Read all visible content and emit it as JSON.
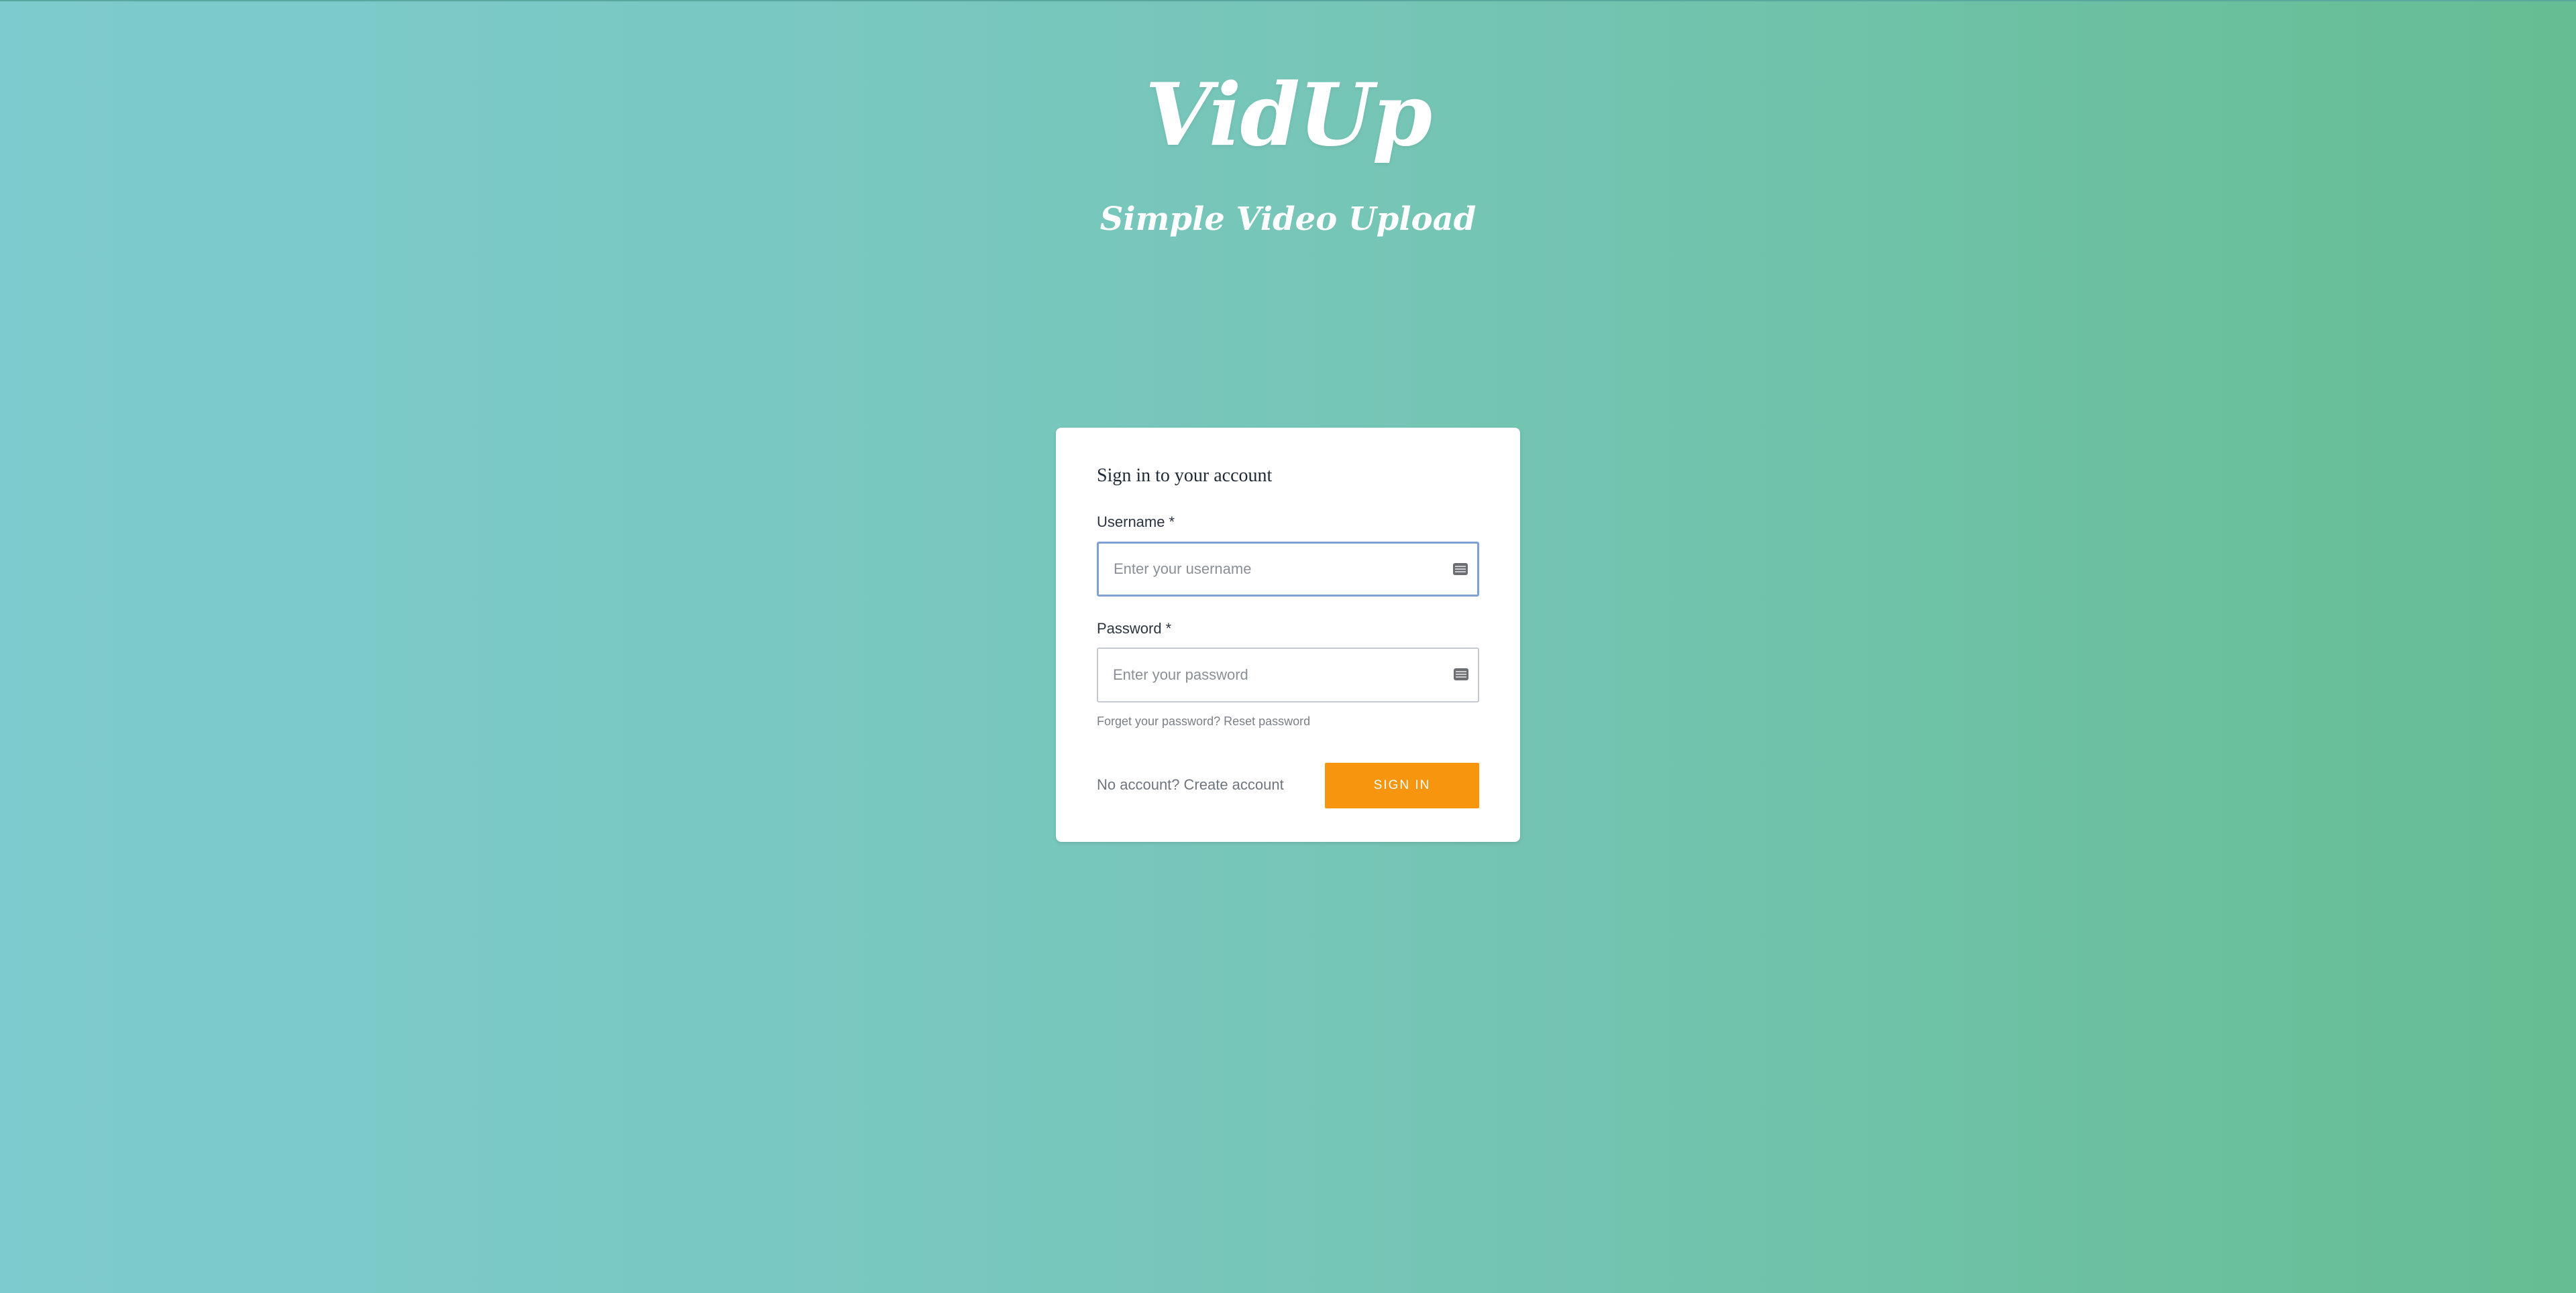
{
  "brand": {
    "logo_text": "VidUp",
    "tagline": "Simple Video Upload"
  },
  "signin_card": {
    "title": "Sign in to your account",
    "username": {
      "label": "Username",
      "required_marker": "*",
      "value": "",
      "placeholder": "Enter your username",
      "icon": "keyboard-icon"
    },
    "password": {
      "label": "Password",
      "required_marker": "*",
      "value": "",
      "placeholder": "Enter your password",
      "icon": "keyboard-icon"
    },
    "forgot_text": "Forget your password?",
    "reset_link": "Reset password",
    "no_account_text": "No account?",
    "create_account_link": "Create account",
    "signin_button": "SIGN IN"
  },
  "colors": {
    "background_left": "#7ecbcf",
    "background_right": "#66bd93",
    "primary_button": "#f7960e",
    "focus_border": "#7ea0d3"
  }
}
